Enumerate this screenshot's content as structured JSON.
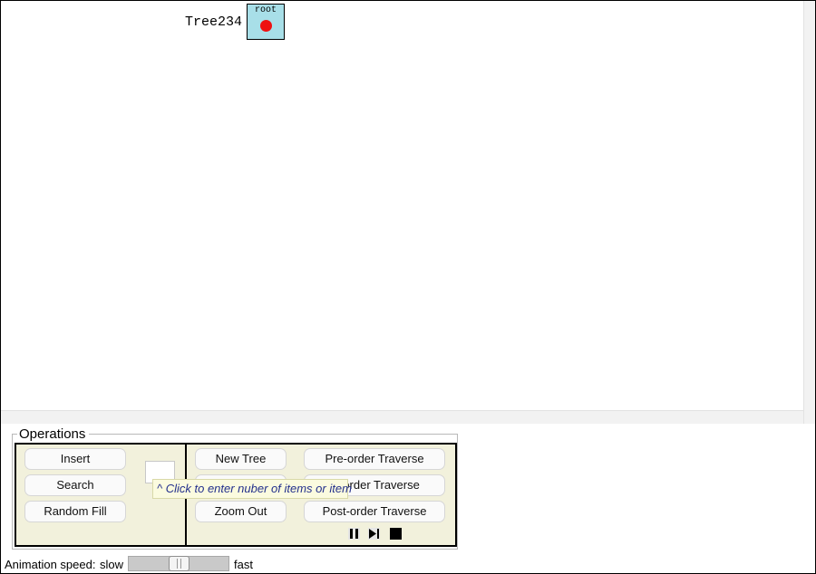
{
  "canvas": {
    "tree_label": "Tree234",
    "root_label": "root"
  },
  "operations": {
    "legend": "Operations",
    "insert_label": "Insert",
    "search_label": "Search",
    "random_fill_label": "Random Fill",
    "number_input_value": "",
    "new_tree_label": "New Tree",
    "zoom_in_label": "",
    "zoom_out_label": "Zoom Out",
    "preorder_label": "Pre-order Traverse",
    "inorder_label": "In-order Traverse",
    "postorder_label": "Post-order Traverse",
    "tooltip": "^ Click to enter nuber of items or item"
  },
  "playback": {
    "pause_icon": "pause-icon",
    "step_icon": "step-forward-icon",
    "stop_icon": "stop-icon"
  },
  "speed": {
    "label": "Animation speed:",
    "slow": "slow",
    "fast": "fast",
    "level": 0.5
  },
  "colors": {
    "root_fill": "#a8dfe8",
    "root_dot": "#ee1111",
    "ops_background": "#f2f1dc",
    "tooltip_text": "#23308c"
  }
}
